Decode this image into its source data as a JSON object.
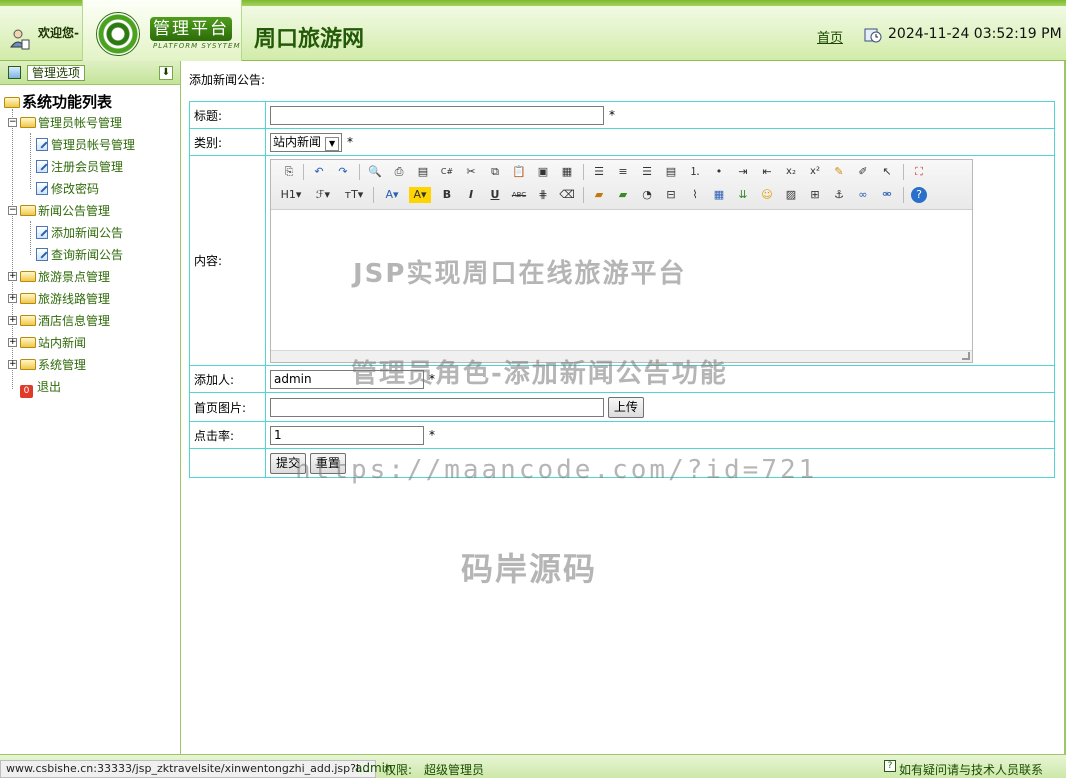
{
  "header": {
    "welcome": "欢迎您-",
    "logo_text": "管理平台",
    "logo_sub": "PLATFORM SYSYTEM",
    "site_title": "周口旅游网",
    "home_link": "首页",
    "datetime": "2024-11-24 03:52:19 PM"
  },
  "sidebar": {
    "header_button": "管理选项",
    "root": "系统功能列表",
    "groups": [
      {
        "label": "管理员帐号管理",
        "children": [
          "管理员帐号管理",
          "注册会员管理",
          "修改密码"
        ]
      },
      {
        "label": "新闻公告管理",
        "children": [
          "添加新闻公告",
          "查询新闻公告"
        ]
      },
      {
        "label": "旅游景点管理"
      },
      {
        "label": "旅游线路管理"
      },
      {
        "label": "酒店信息管理"
      },
      {
        "label": "站内新闻"
      },
      {
        "label": "系统管理"
      }
    ],
    "exit": "退出"
  },
  "content": {
    "breadcrumb": "添加新闻公告:",
    "form": {
      "title_label": "标题:",
      "title_value": "",
      "category_label": "类别:",
      "category_value": "站内新闻",
      "content_label": "内容:",
      "adder_label": "添加人:",
      "adder_value": "admin",
      "image_label": "首页图片:",
      "upload_button": "上传",
      "clicks_label": "点击率:",
      "clicks_value": "1",
      "required": "*",
      "submit_button": "提交",
      "reset_button": "重置"
    },
    "toolbar_row1": [
      "source",
      "undo",
      "redo",
      "preview",
      "print",
      "template",
      "code",
      "cut",
      "copy",
      "paste",
      "paste-text",
      "paste-word",
      "align-left",
      "align-center",
      "align-right",
      "justify",
      "ordered-list",
      "unordered-list",
      "indent",
      "outdent",
      "subscript",
      "superscript",
      "clear-format",
      "select-all",
      "select",
      "fullscreen"
    ],
    "toolbar_row2": [
      "heading",
      "font-family",
      "font-size",
      "font-color",
      "highlight",
      "bold",
      "italic",
      "underline",
      "strikethrough",
      "hr",
      "remove-format",
      "image",
      "flash",
      "media",
      "table",
      "attachment",
      "emoticon",
      "insert-image",
      "page-break",
      "anchor",
      "link",
      "unlink",
      "help"
    ]
  },
  "watermarks": {
    "line1": "JSP实现周口在线旅游平台",
    "line2": "管理员角色-添加新闻公告功能",
    "line3": "https://maancode.com/?id=721",
    "line4": "码岸源码"
  },
  "footer": {
    "status_url": "www.csbishe.cn:33333/jsp_zktravelsite/xinwentongzhi_add.jsp?l...",
    "user": "admin",
    "role_label": "权限:",
    "role": "超级管理员",
    "help": "如有疑问请与技术人员联系"
  },
  "colors": {
    "accent_green": "#4f9d1b",
    "border_cyan": "#4fd5d5",
    "sidebar_text": "#2f6a0a"
  }
}
